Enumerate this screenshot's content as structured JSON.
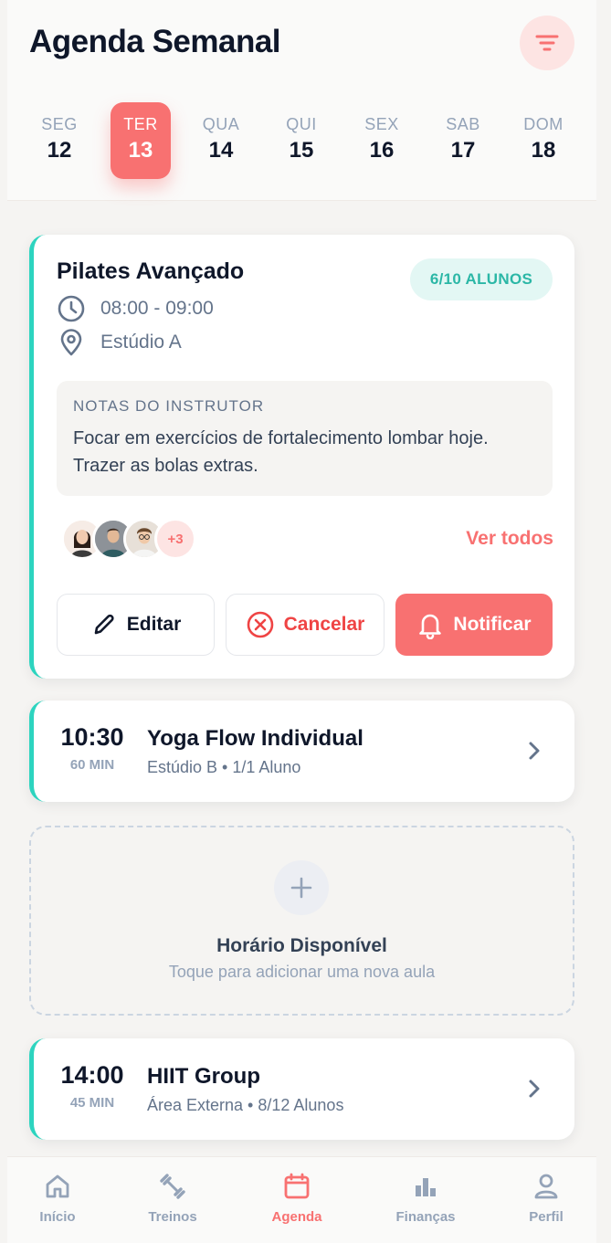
{
  "header": {
    "title": "Agenda Semanal",
    "filter_icon": "filter-icon"
  },
  "week": {
    "selected_index": 1,
    "days": [
      {
        "name": "SEG",
        "num": "12"
      },
      {
        "name": "TER",
        "num": "13"
      },
      {
        "name": "QUA",
        "num": "14"
      },
      {
        "name": "QUI",
        "num": "15"
      },
      {
        "name": "SEX",
        "num": "16"
      },
      {
        "name": "SAB",
        "num": "17"
      },
      {
        "name": "DOM",
        "num": "18"
      }
    ]
  },
  "featured_class": {
    "title": "Pilates Avançado",
    "badge": "6/10 ALUNOS",
    "time": "08:00 - 09:00",
    "location": "Estúdio A",
    "notes_label": "NOTAS DO INSTRUTOR",
    "notes_text": "Focar em exercícios de fortalecimento lombar hoje. Trazer as bolas extras.",
    "extra_students": "+3",
    "see_all": "Ver todos",
    "actions": {
      "edit": "Editar",
      "cancel": "Cancelar",
      "notify": "Notificar"
    }
  },
  "classes": [
    {
      "time": "10:30",
      "duration": "60 MIN",
      "title": "Yoga Flow Individual",
      "subtitle": "Estúdio B • 1/1 Aluno"
    },
    {
      "time": "14:00",
      "duration": "45 MIN",
      "title": "HIIT Group",
      "subtitle": "Área Externa • 8/12 Alunos"
    }
  ],
  "empty_slot": {
    "title": "Horário Disponível",
    "subtitle": "Toque para adicionar uma nova aula"
  },
  "nav": {
    "active_index": 2,
    "items": [
      {
        "label": "Início",
        "icon": "home-icon"
      },
      {
        "label": "Treinos",
        "icon": "dumbbell-icon"
      },
      {
        "label": "Agenda",
        "icon": "calendar-icon"
      },
      {
        "label": "Finanças",
        "icon": "bar-chart-icon"
      },
      {
        "label": "Perfil",
        "icon": "user-icon"
      }
    ]
  },
  "colors": {
    "accent": "#f87171",
    "teal": "#2dd4bf",
    "text": "#0f172a",
    "muted": "#64748b"
  }
}
